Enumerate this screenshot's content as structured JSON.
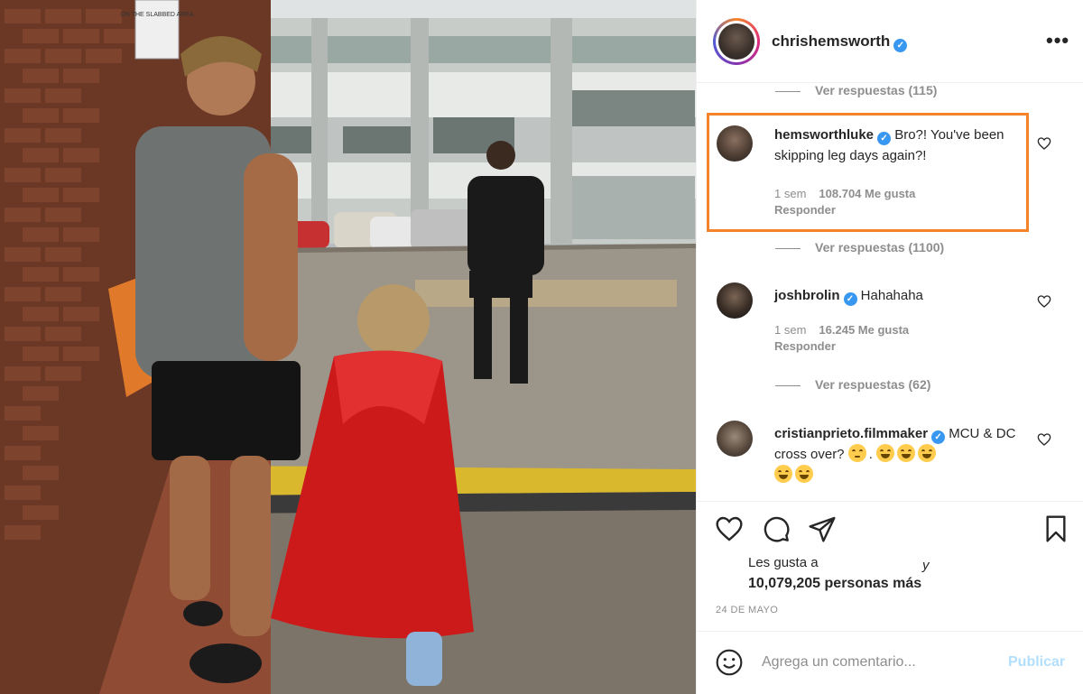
{
  "post": {
    "username": "chrishemsworth",
    "verified_icon": "verified-badge-icon",
    "sign_text": "ON THE SLABBED AREA"
  },
  "comments_section": {
    "view_replies_1": "Ver respuestas (115)",
    "comments": [
      {
        "username": "hemsworthluke",
        "text": "Bro?! You've been skipping leg days again?!",
        "time": "1 sem",
        "likes": "108.704 Me gusta",
        "reply": "Responder",
        "highlighted": true
      },
      {
        "username": "joshbrolin",
        "text": "Hahahaha",
        "time": "1 sem",
        "likes": "16.245 Me gusta",
        "reply": "Responder"
      },
      {
        "username": "cristianprieto.filmmaker",
        "text": "MCU & DC cross over? ",
        "text_end": ".",
        "emojis": [
          "thinking-face",
          "grinning-sweat",
          "tears-of-joy",
          "grinning-sweat",
          "tears-of-joy",
          "grinning-sweat"
        ]
      }
    ],
    "view_replies_2": "Ver respuestas (1100)",
    "view_replies_3": "Ver respuestas (62)"
  },
  "actions": {
    "likes_prefix": "Les gusta a",
    "likes_conj": "y",
    "likes_count": "10,079,205 personas más",
    "date": "24 DE MAYO"
  },
  "add_comment": {
    "placeholder": "Agrega un comentario...",
    "publish_label": "Publicar"
  },
  "colors": {
    "highlight_border": "#f5832a",
    "verified_blue": "#3897f0",
    "publish_disabled": "#b2dffc",
    "secondary_text": "#8e8e8e"
  }
}
